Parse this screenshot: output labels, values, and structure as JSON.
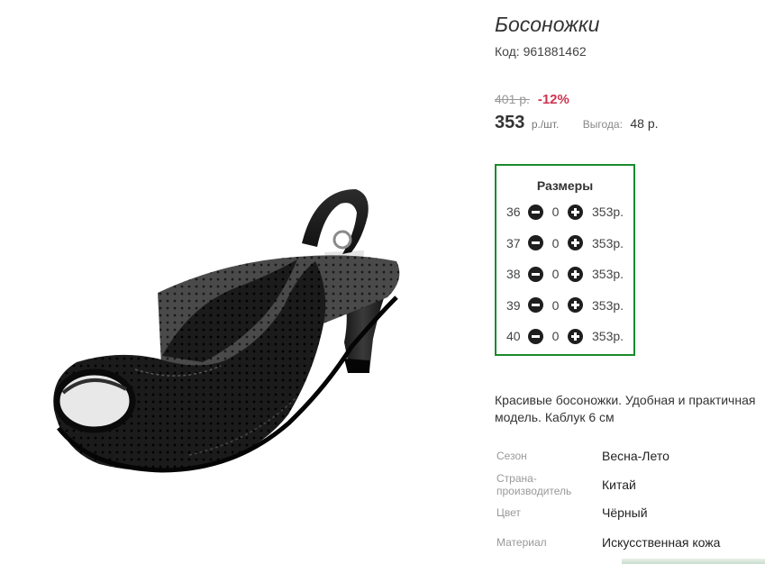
{
  "product": {
    "title": "Босоножки",
    "code": "Код: 961881462",
    "image_icon": "sandal-image"
  },
  "pricing": {
    "old_price": "401 р.",
    "discount": "-12%",
    "price": "353",
    "unit": "р./шт.",
    "benefit_label": "Выгода:",
    "benefit_value": "48 р."
  },
  "sizes": {
    "title": "Размеры",
    "rows": [
      {
        "size": "36",
        "qty": "0",
        "price": "353р."
      },
      {
        "size": "37",
        "qty": "0",
        "price": "353р."
      },
      {
        "size": "38",
        "qty": "0",
        "price": "353р."
      },
      {
        "size": "39",
        "qty": "0",
        "price": "353р."
      },
      {
        "size": "40",
        "qty": "0",
        "price": "353р."
      }
    ],
    "border_color": "#1a8a2a"
  },
  "description": "Красивые босоножки. Удобная и практичная модель. Каблук 6 см",
  "specs": [
    {
      "label": "Сезон",
      "value": "Весна-Лето"
    },
    {
      "label": "Страна-производитель",
      "value": "Китай"
    },
    {
      "label": "Цвет",
      "value": "Чёрный"
    },
    {
      "label": "Материал",
      "value": "Искусственная кожа"
    }
  ],
  "colors": {
    "discount": "#d0344f",
    "accent_border": "#1a8a2a"
  }
}
